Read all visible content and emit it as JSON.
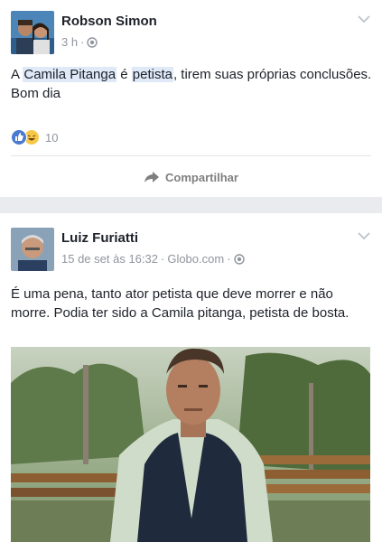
{
  "post1": {
    "author": "Robson Simon",
    "time": "3 h",
    "text_part1": "A ",
    "text_hl1": "Camila Pitanga",
    "text_part2": " é ",
    "text_hl2": "petista",
    "text_part3": ", tirem suas próprias conclusões.",
    "text_line2": "Bom dia",
    "reaction_count": "10",
    "share_label": "Compartilhar",
    "icons": {
      "chevron": "chevron-down-icon",
      "globe": "globe-icon",
      "like": "like-reaction-icon",
      "haha": "haha-reaction-icon",
      "share": "share-arrow-icon"
    }
  },
  "post2": {
    "author": "Luiz Furiatti",
    "time": "15 de set às 16:32",
    "source": "Globo.com",
    "text": "É uma pena, tanto ator petista que deve morrer e não morre. Podia ter sido a Camila pitanga, petista de bosta."
  },
  "colors": {
    "background": "#e9ebee",
    "card": "#ffffff",
    "text": "#1d2129",
    "meta": "#90949c",
    "like_blue": "#4a7bd0",
    "haha_yellow": "#f7c847",
    "highlight": "#dfe9f7"
  }
}
